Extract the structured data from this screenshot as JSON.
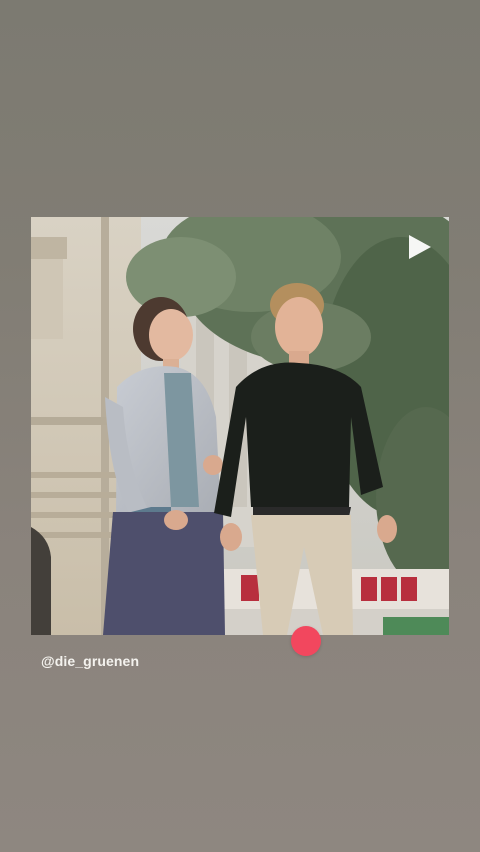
{
  "story": {
    "mention": "@die_gruenen",
    "media": {
      "type": "video",
      "play_icon": "play-icon"
    },
    "reaction": {
      "icon": "like-dot",
      "color": "#f2475e"
    }
  }
}
